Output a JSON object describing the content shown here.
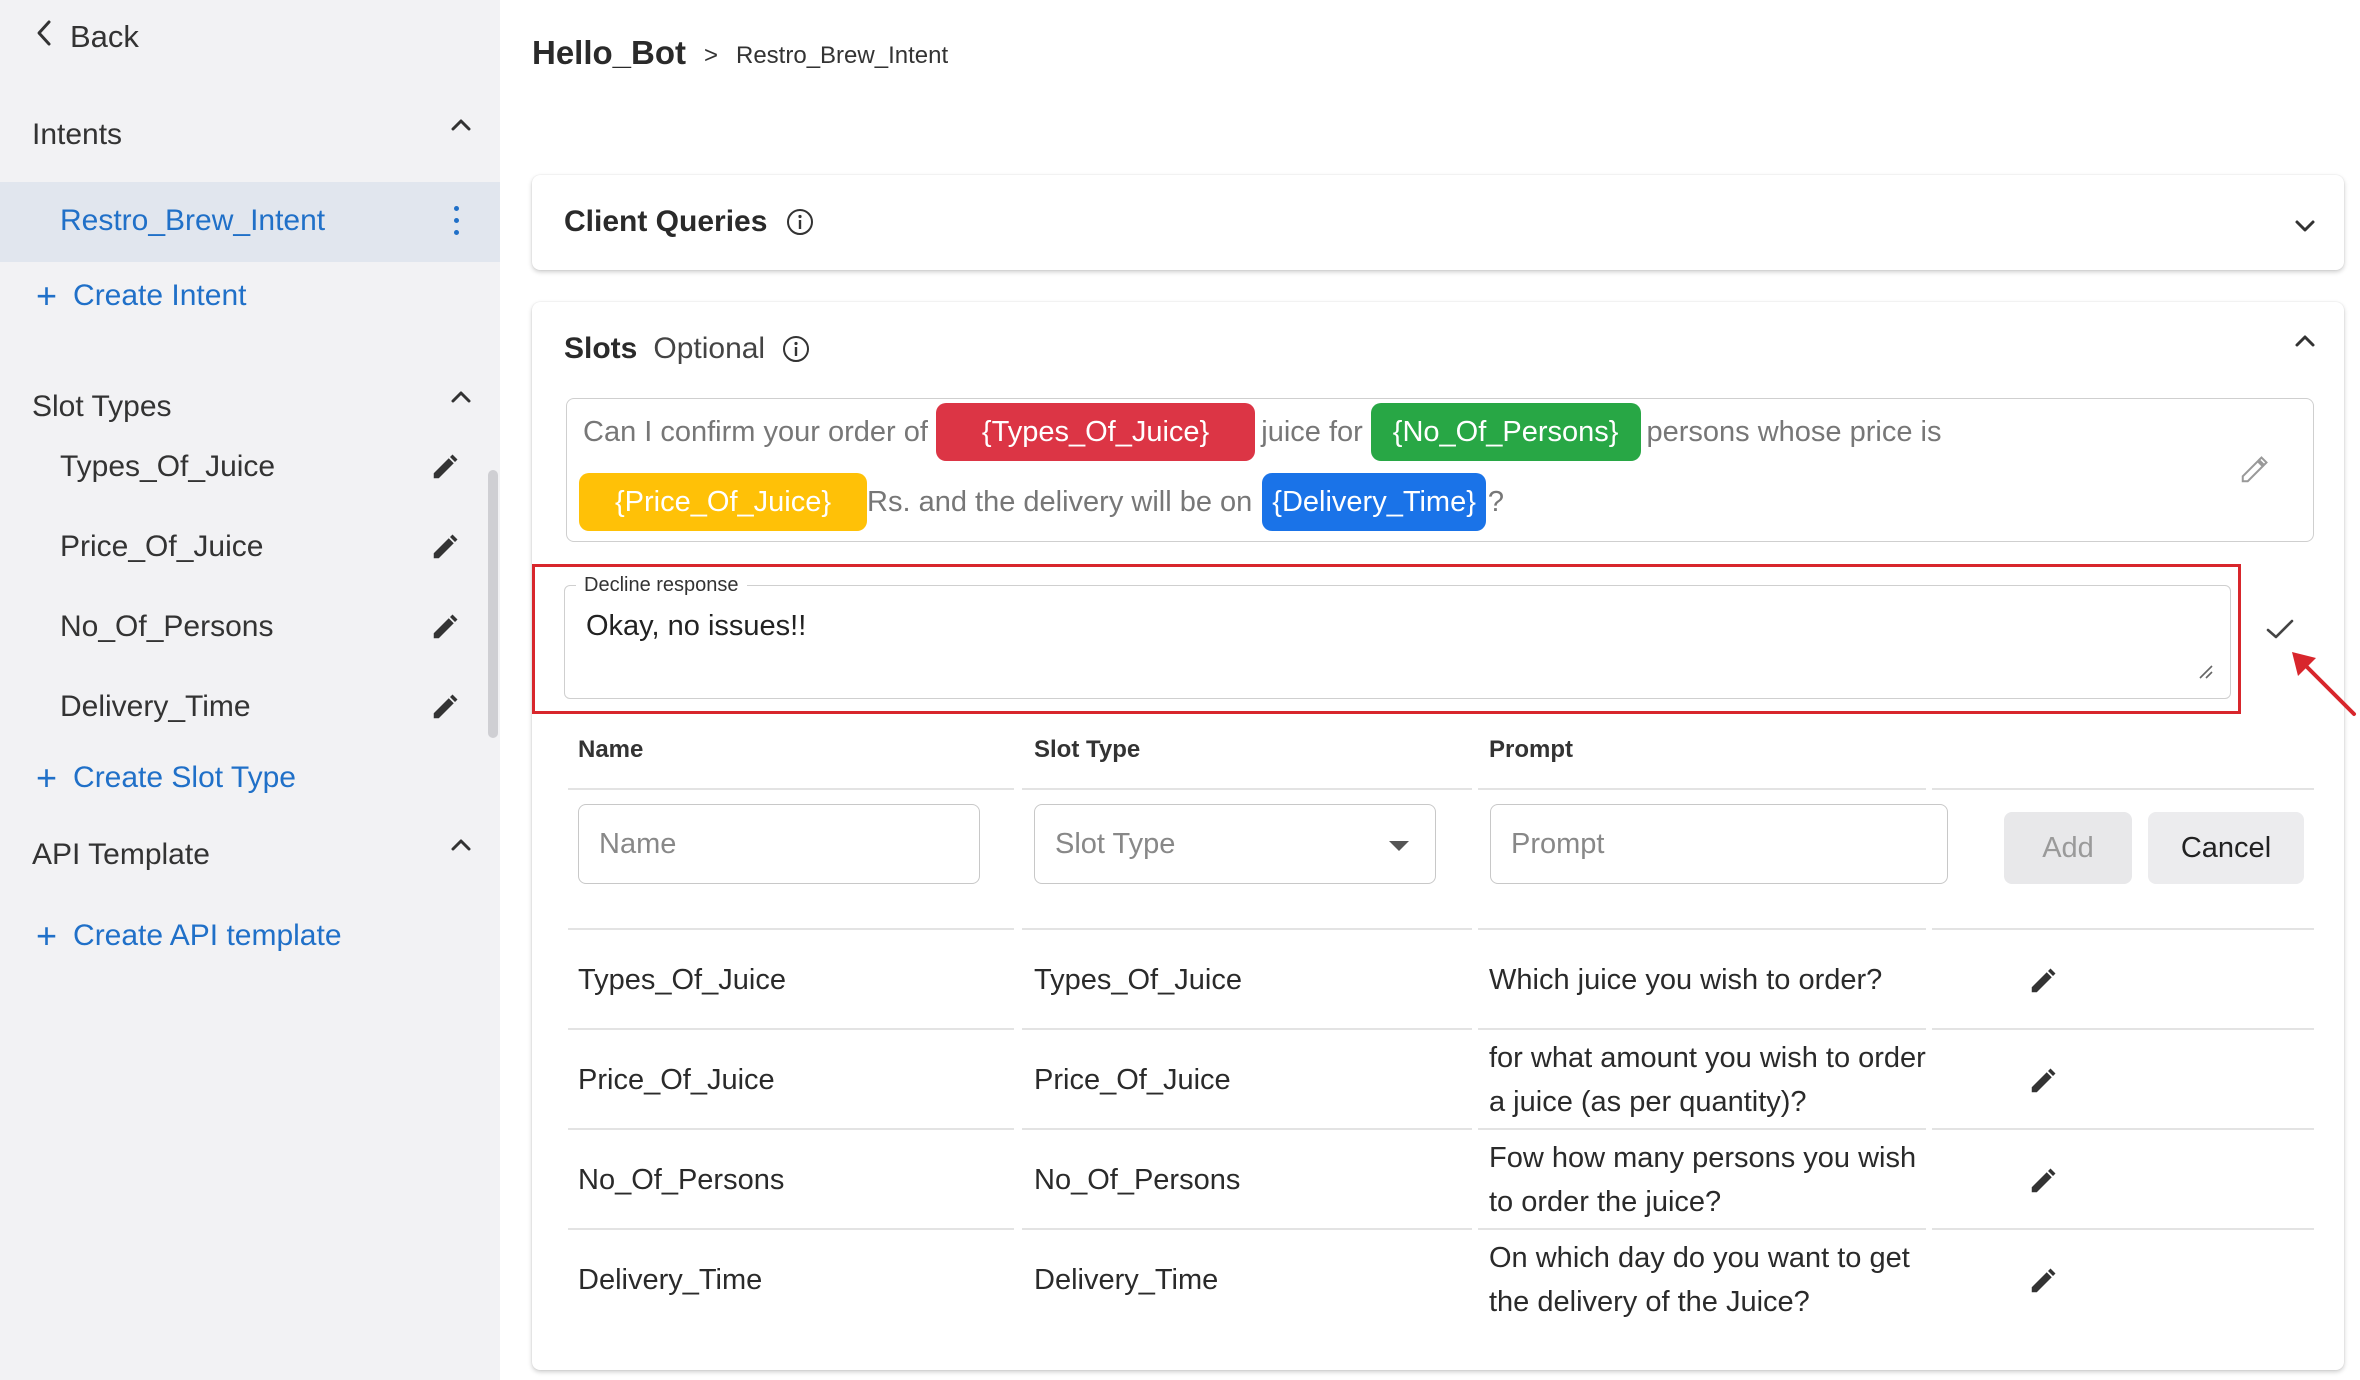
{
  "sidebar": {
    "back_label": "Back",
    "intents": {
      "title": "Intents",
      "items": [
        {
          "label": "Restro_Brew_Intent"
        }
      ],
      "create_label": "Create Intent"
    },
    "slot_types": {
      "title": "Slot Types",
      "items": [
        {
          "label": "Types_Of_Juice"
        },
        {
          "label": "Price_Of_Juice"
        },
        {
          "label": "No_Of_Persons"
        },
        {
          "label": "Delivery_Time"
        }
      ],
      "create_label": "Create Slot Type"
    },
    "api_template": {
      "title": "API Template",
      "create_label": "Create API template"
    }
  },
  "breadcrumb": {
    "bot": "Hello_Bot",
    "separator": ">",
    "intent": "Restro_Brew_Intent"
  },
  "client_queries": {
    "title": "Client Queries"
  },
  "slots": {
    "title": "Slots",
    "optional_label": "Optional",
    "confirmation": {
      "t1": "Can I confirm your order of",
      "chip1": "{Types_Of_Juice}",
      "t2": "juice for",
      "chip2": "{No_Of_Persons}",
      "t3": "persons whose price is",
      "chip3": "{Price_Of_Juice}",
      "t4": "Rs. and the delivery will be on",
      "chip4": "{Delivery_Time}",
      "t5": "?"
    },
    "decline": {
      "label": "Decline response",
      "value": "Okay, no issues!!"
    },
    "table": {
      "headers": {
        "name": "Name",
        "slot_type": "Slot Type",
        "prompt": "Prompt"
      },
      "new_row": {
        "name_placeholder": "Name",
        "slot_type_placeholder": "Slot Type",
        "prompt_placeholder": "Prompt",
        "add_label": "Add",
        "cancel_label": "Cancel"
      },
      "rows": [
        {
          "name": "Types_Of_Juice",
          "slot_type": "Types_Of_Juice",
          "prompt_l1": "Which juice you wish to order?",
          "prompt_l2": ""
        },
        {
          "name": "Price_Of_Juice",
          "slot_type": "Price_Of_Juice",
          "prompt_l1": "for what amount you wish to order",
          "prompt_l2": "a juice (as per quantity)?"
        },
        {
          "name": "No_Of_Persons",
          "slot_type": "No_Of_Persons",
          "prompt_l1": "Fow how many persons you wish",
          "prompt_l2": "to order the juice?"
        },
        {
          "name": "Delivery_Time",
          "slot_type": "Delivery_Time",
          "prompt_l1": "On which day do you want to get",
          "prompt_l2": "the delivery of the Juice?"
        }
      ]
    }
  },
  "colors": {
    "accent": "#2070c8",
    "chip_red": "#dc3545",
    "chip_green": "#28a745",
    "chip_yellow": "#ffc107",
    "chip_blue": "#1a73e8",
    "highlight_box": "#d8262c"
  }
}
